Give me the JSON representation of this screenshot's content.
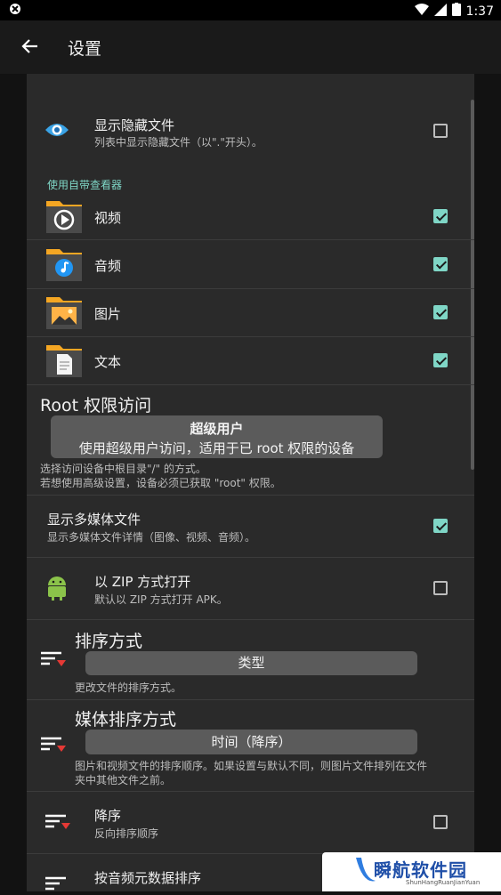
{
  "status": {
    "time": "1:37"
  },
  "appbar": {
    "title": "设置"
  },
  "items": {
    "hidden_files": {
      "title": "显示隐藏文件",
      "subtitle": "列表中显示隐藏文件（以\".\"开头）。",
      "checked": false
    },
    "viewer_header": "使用自带查看器",
    "video": {
      "label": "视频",
      "checked": true
    },
    "audio": {
      "label": "音频",
      "checked": true
    },
    "image": {
      "label": "图片",
      "checked": true
    },
    "text": {
      "label": "文本",
      "checked": true
    },
    "root": {
      "title": "Root 权限访问",
      "button_title": "超级用户",
      "button_subtitle": "使用超级用户访问，适用于已 root 权限的设备",
      "desc_line1": "选择访问设备中根目录\"/\" 的方式。",
      "desc_line2": "若想使用高级设置，设备必须已获取 \"root\" 权限。"
    },
    "media_files": {
      "title": "显示多媒体文件",
      "subtitle": "显示多媒体文件详情（图像、视频、音频）。",
      "checked": true
    },
    "zip": {
      "title": "以 ZIP 方式打开",
      "subtitle": "默认以 ZIP 方式打开 APK。",
      "checked": false
    },
    "sort": {
      "title": "排序方式",
      "button": "类型",
      "desc": "更改文件的排序方式。"
    },
    "media_sort": {
      "title": "媒体排序方式",
      "button": "时间（降序）",
      "desc_line1": "图片和视频文件的排序顺序。如果设置与默认不同，则图片文件排列在文件",
      "desc_line2": "夹中其他文件之前。"
    },
    "descending": {
      "title": "降序",
      "subtitle": "反向排序顺序",
      "checked": false
    },
    "audio_meta": {
      "title": "按音频元数据排序"
    }
  },
  "watermark": {
    "text": "瞬航软件园",
    "sub": "ShunHangRuanJianYuan"
  },
  "colors": {
    "accent": "#7fd6c6",
    "background": "#2a2a2a",
    "sort_arrow": "#e53935"
  }
}
